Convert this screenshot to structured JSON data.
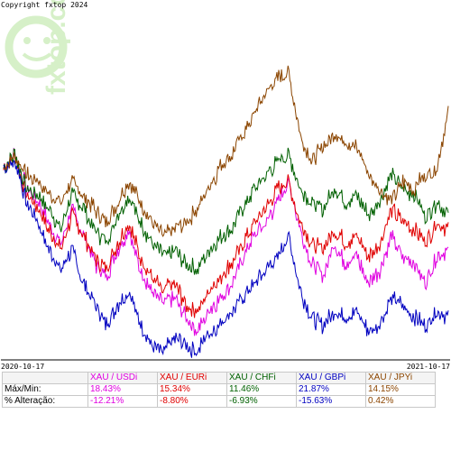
{
  "copyright": "Copyright fxtop 2024",
  "watermark": {
    "text": "fxtop.com",
    "color": "#d6f0c8"
  },
  "chart_data": {
    "type": "line",
    "x_start_label": "2020-10-17",
    "x_end_label": "2021-10-17",
    "ylim": [
      -28,
      23
    ],
    "series": [
      {
        "name": "XAU / USD",
        "color": "#e000e0",
        "max_min": "18.43%",
        "change": "-12.21%",
        "values": [
          0,
          2,
          -3,
          -5,
          -8,
          -11,
          -6,
          -10,
          -14,
          -16,
          -12,
          -9,
          -15,
          -18,
          -20,
          -19,
          -22,
          -24,
          -21,
          -19,
          -17,
          -13,
          -10,
          -8,
          -5,
          -2,
          -9,
          -14,
          -16,
          -11,
          -14,
          -13,
          -17,
          -15,
          -10,
          -13,
          -14,
          -17,
          -13,
          -12
        ]
      },
      {
        "name": "XAU / EUR",
        "color": "#e00000",
        "max_min": "15.34%",
        "change": "-8.80%",
        "values": [
          0,
          2,
          -4,
          -6,
          -9,
          -12,
          -7,
          -10,
          -13,
          -15,
          -11,
          -8,
          -13,
          -16,
          -18,
          -17,
          -20,
          -21,
          -18,
          -16,
          -14,
          -11,
          -8,
          -6,
          -3,
          -2,
          -8,
          -11,
          -12,
          -9,
          -11,
          -10,
          -13,
          -11,
          -6,
          -8,
          -9,
          -11,
          -8,
          -9
        ]
      },
      {
        "name": "XAU / CHF",
        "color": "#006000",
        "max_min": "11.46%",
        "change": "-6.93%",
        "values": [
          0,
          2,
          -3,
          -4,
          -6,
          -9,
          -4,
          -6,
          -9,
          -11,
          -7,
          -4,
          -8,
          -11,
          -13,
          -12,
          -14,
          -15,
          -12,
          -10,
          -9,
          -6,
          -3,
          -1,
          1,
          2,
          -3,
          -5,
          -6,
          -3,
          -5,
          -4,
          -7,
          -5,
          -1,
          -3,
          -4,
          -7,
          -5,
          -7
        ]
      },
      {
        "name": "XAU / GBP",
        "color": "#0000c0",
        "max_min": "21.87%",
        "change": "-15.63%",
        "values": [
          0,
          1,
          -5,
          -8,
          -12,
          -15,
          -12,
          -17,
          -20,
          -23,
          -20,
          -18,
          -23,
          -26,
          -27,
          -25,
          -26,
          -27,
          -24,
          -23,
          -21,
          -19,
          -17,
          -15,
          -13,
          -10,
          -18,
          -22,
          -23,
          -21,
          -22,
          -21,
          -24,
          -23,
          -19,
          -20,
          -22,
          -23,
          -21,
          -22
        ]
      },
      {
        "name": "XAU / JPY",
        "color": "#8b4500",
        "max_min": "14.15%",
        "change": "0.42%",
        "values": [
          0,
          2,
          -1,
          -2,
          -4,
          -5,
          -2,
          -4,
          -6,
          -8,
          -5,
          -2,
          -5,
          -8,
          -10,
          -9,
          -8,
          -6,
          -3,
          0,
          2,
          5,
          8,
          11,
          13,
          14,
          5,
          1,
          3,
          5,
          4,
          3,
          -1,
          -3,
          -5,
          -2,
          -3,
          -1,
          0,
          8
        ]
      }
    ]
  },
  "table": {
    "header": [
      "",
      "XAU / USDi",
      "XAU / EURi",
      "XAU / CHFi",
      "XAU / GBPi",
      "XAU / JPYi"
    ],
    "header_colors": [
      "#000000",
      "#e000e0",
      "#e00000",
      "#006000",
      "#0000c0",
      "#8b4500"
    ],
    "rows": [
      {
        "label": "Máx/Min:",
        "values": [
          "18.43%",
          "15.34%",
          "11.46%",
          "21.87%",
          "14.15%"
        ]
      },
      {
        "label": "% Alteração:",
        "values": [
          "-12.21%",
          "-8.80%",
          "-6.93%",
          "-15.63%",
          "0.42%"
        ]
      }
    ]
  }
}
